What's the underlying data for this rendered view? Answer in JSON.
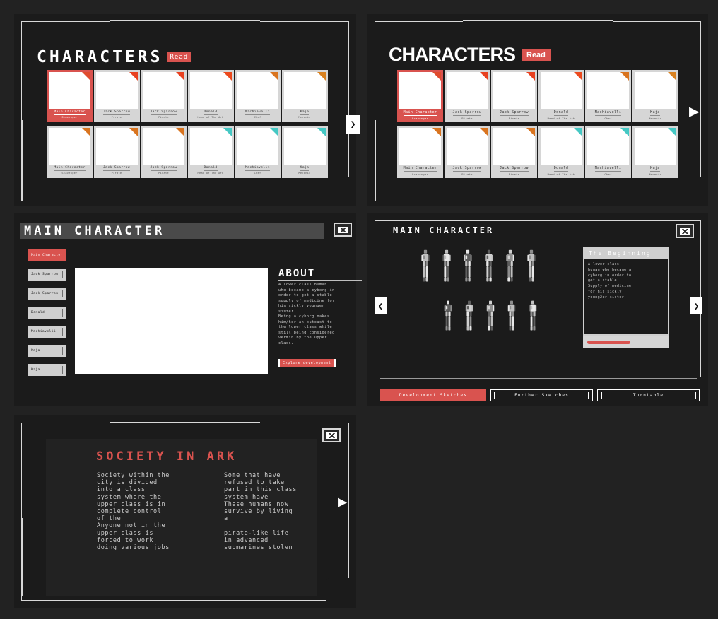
{
  "theme": {
    "background": "#222222",
    "panel": "#1b1b1b",
    "accent_red": "#d9534f",
    "border_light": "#d8d8d8",
    "text_light": "#cfcfcf"
  },
  "panel_characters_pixel": {
    "title": "CHARACTERS",
    "read_badge": "Read",
    "next_arrow_icon": "chevron-right-icon",
    "rows": [
      {
        "cards": [
          {
            "name": "Main Character",
            "role": "Scavenger",
            "corner": "#e04b2e",
            "selected": true
          },
          {
            "name": "Jack Sparrow",
            "role": "Pirate",
            "corner": "#e8401f",
            "selected": false
          },
          {
            "name": "Jack Sparrow",
            "role": "Pirate",
            "corner": "#e8401f",
            "selected": false
          },
          {
            "name": "Donald",
            "role": "Head of The Ark",
            "corner": "#ec4a1e",
            "selected": false
          },
          {
            "name": "Machiavelli",
            "role": "Chef",
            "corner": "#d9741f",
            "selected": false
          },
          {
            "name": "Kaja",
            "role": "Mecanic",
            "corner": "#d9811f",
            "selected": false
          }
        ]
      },
      {
        "cards": [
          {
            "name": "Main Character",
            "role": "Scavenger",
            "corner": "#d9741f",
            "selected": false
          },
          {
            "name": "Jack Sparrow",
            "role": "Pirate",
            "corner": "#d9741f",
            "selected": false
          },
          {
            "name": "Jack Sparrow",
            "role": "Pirate",
            "corner": "#d9741f",
            "selected": false
          },
          {
            "name": "Donald",
            "role": "Head of The Ark",
            "corner": "#45c8c4",
            "selected": false
          },
          {
            "name": "Machiavelli",
            "role": "Chef",
            "corner": "#45c8c4",
            "selected": false
          },
          {
            "name": "Kaja",
            "role": "Mecanic",
            "corner": "#45c8c4",
            "selected": false
          }
        ]
      }
    ]
  },
  "panel_characters_clean": {
    "title": "CHARACTERS",
    "read_badge": "Read",
    "next_arrow_icon": "triangle-right-icon",
    "rows": [
      {
        "cards": [
          {
            "name": "Main Character",
            "role": "Scavenger",
            "corner": "#e04b2e",
            "selected": true
          },
          {
            "name": "Jack Sparrow",
            "role": "Pirate",
            "corner": "#e8401f",
            "selected": false
          },
          {
            "name": "Jack Sparrow",
            "role": "Pirate",
            "corner": "#e8401f",
            "selected": false
          },
          {
            "name": "Donald",
            "role": "Head of The Ark",
            "corner": "#ec4a1e",
            "selected": false
          },
          {
            "name": "Machiavelli",
            "role": "Chef",
            "corner": "#d9741f",
            "selected": false
          },
          {
            "name": "Kaja",
            "role": "Mecanic",
            "corner": "#d9811f",
            "selected": false
          }
        ]
      },
      {
        "cards": [
          {
            "name": "Main Character",
            "role": "Scavenger",
            "corner": "#d9741f",
            "selected": false
          },
          {
            "name": "Jack Sparrow",
            "role": "Pirate",
            "corner": "#d9741f",
            "selected": false
          },
          {
            "name": "Jack Sparrow",
            "role": "Pirate",
            "corner": "#d9741f",
            "selected": false
          },
          {
            "name": "Donald",
            "role": "Head of The Ark",
            "corner": "#45c8c4",
            "selected": false
          },
          {
            "name": "Machiavelli",
            "role": "Chef",
            "corner": "#45c8c4",
            "selected": false
          },
          {
            "name": "Kaja",
            "role": "Mecanic",
            "corner": "#45c8c4",
            "selected": false
          }
        ]
      }
    ]
  },
  "panel_main_character": {
    "header_title": "MAIN CHARACTER",
    "mail_icon": "mail-icon",
    "sidebar": [
      {
        "label": "Main Character",
        "active": true
      },
      {
        "label": "Jack Sparrow",
        "active": false
      },
      {
        "label": "Jack Sparrow",
        "active": false
      },
      {
        "label": "Donald",
        "active": false
      },
      {
        "label": "Machiavelli",
        "active": false
      },
      {
        "label": "Kaja",
        "active": false
      },
      {
        "label": "Kaja",
        "active": false
      }
    ],
    "about_title": "ABOUT",
    "about_body": "A lower class human\nwho became a cyborg in\norder to get a stable\nsupply of medicine for\nhis sickly younger\nsister.\nBeing a cyborg makes\nhim/her an outcast to\nthe lower class while\nstill being considered\nvermin by the upper\nclass.",
    "explore_button": "Explore development"
  },
  "panel_sketches": {
    "title": "MAIN\nCHARACTER",
    "mail_icon": "mail-icon",
    "prev_arrow_icon": "chevron-left-icon",
    "next_arrow_icon": "chevron-right-icon",
    "beginning_title": "The Beginning",
    "beginning_body": "A lower class\nhuman who became a\ncyborg in order to\nget a stable.\nSupply of medicine\nfor his sickly\nyoung2er sister.",
    "progress_percent": 55,
    "tabs": [
      {
        "label": "Development Sketches",
        "active": true
      },
      {
        "label": "Further Sketches",
        "active": false
      },
      {
        "label": "Turntable",
        "active": false
      }
    ]
  },
  "panel_society": {
    "mail_icon": "mail-icon",
    "title": "SOCIETY IN ARK",
    "next_arrow_icon": "triangle-right-icon",
    "column_left": "Society within the\ncity is divided\ninto a class\nsystem where the\nupper class is in\ncomplete control\nof the\nAnyone not in the\nupper class is\nforced to work\ndoing various jobs",
    "column_right": "Some that have\nrefused to take\npart in this class\nsystem have\nThese humans now\nsurvive by living\na\n\npirate-like life\nin advanced\nsubmarines stolen"
  }
}
